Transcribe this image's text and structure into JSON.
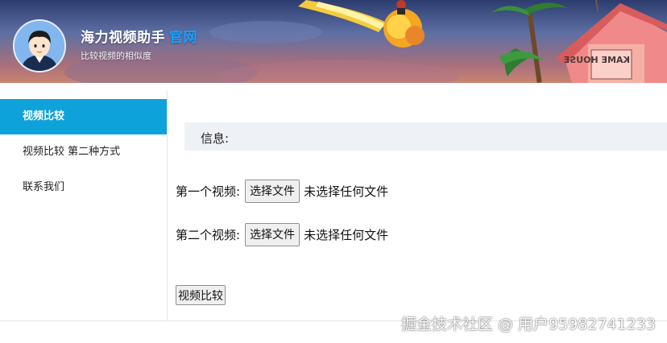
{
  "header": {
    "title": "海力视频助手",
    "official_link": "官网",
    "subtitle": "比较视频的相似度",
    "house_sign": "KAME HOUSE"
  },
  "sidebar": {
    "items": [
      {
        "label": "视频比较",
        "active": true
      },
      {
        "label": "视频比较 第二种方式",
        "active": false
      },
      {
        "label": "联系我们",
        "active": false
      }
    ]
  },
  "main": {
    "info_label": "信息:",
    "file_inputs": [
      {
        "label": "第一个视频:",
        "button": "选择文件",
        "status": "未选择任何文件"
      },
      {
        "label": "第二个视频:",
        "button": "选择文件",
        "status": "未选择任何文件"
      }
    ],
    "compare_button": "视频比较"
  },
  "watermark": "掘金技术社区 @ 用户95982741233",
  "colors": {
    "accent": "#0ea2da",
    "link": "#19a0ff",
    "info_bg": "#eef1f6"
  }
}
